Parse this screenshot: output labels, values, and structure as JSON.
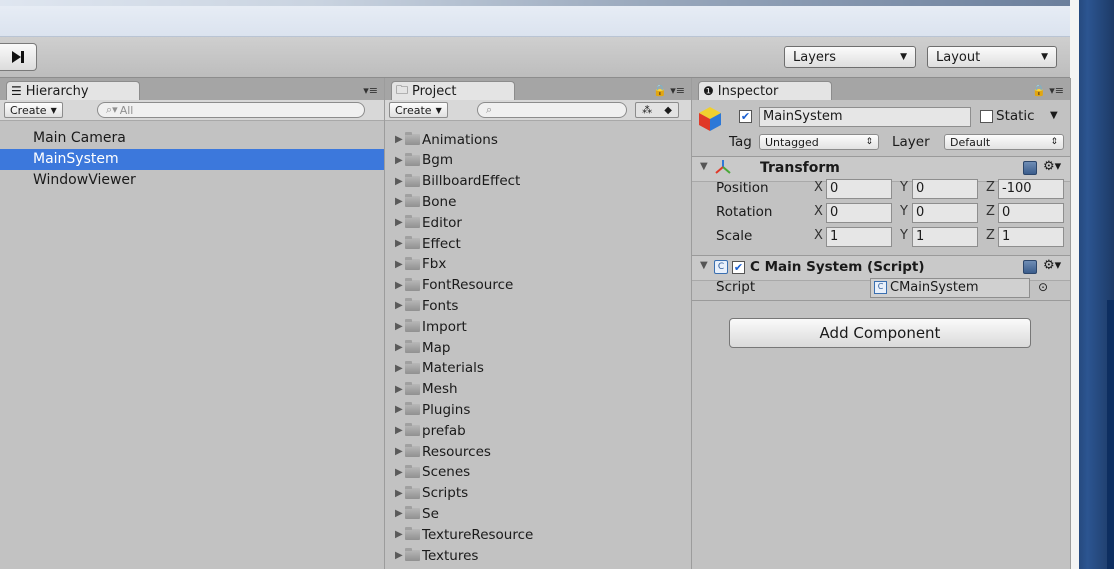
{
  "toolbar": {
    "step_icon": "step-forward-icon",
    "layers_label": "Layers",
    "layout_label": "Layout"
  },
  "hierarchy": {
    "tab_label": "Hierarchy",
    "create_label": "Create",
    "search_placeholder": "All",
    "items": [
      "Main Camera",
      "MainSystem",
      "WindowViewer"
    ],
    "selected": "MainSystem"
  },
  "project": {
    "tab_label": "Project",
    "create_label": "Create",
    "folders": [
      "Animations",
      "Bgm",
      "BillboardEffect",
      "Bone",
      "Editor",
      "Effect",
      "Fbx",
      "FontResource",
      "Fonts",
      "Import",
      "Map",
      "Materials",
      "Mesh",
      "Plugins",
      "prefab",
      "Resources",
      "Scenes",
      "Scripts",
      "Se",
      "TextureResource",
      "Textures"
    ]
  },
  "inspector": {
    "tab_label": "Inspector",
    "object_name": "MainSystem",
    "static_label": "Static",
    "tag_label": "Tag",
    "tag_value": "Untagged",
    "layer_label": "Layer",
    "layer_value": "Default",
    "transform": {
      "title": "Transform",
      "rows": [
        {
          "label": "Position",
          "x": "0",
          "y": "0",
          "z": "-100"
        },
        {
          "label": "Rotation",
          "x": "0",
          "y": "0",
          "z": "0"
        },
        {
          "label": "Scale",
          "x": "1",
          "y": "1",
          "z": "1"
        }
      ]
    },
    "script_component": {
      "title": "C Main System (Script)",
      "script_label": "Script",
      "script_value": "CMainSystem"
    },
    "add_component_label": "Add Component"
  },
  "colors": {
    "selection": "#3c78dc",
    "panel": "#c2c2c2",
    "tabbar": "#a5a5a5"
  }
}
